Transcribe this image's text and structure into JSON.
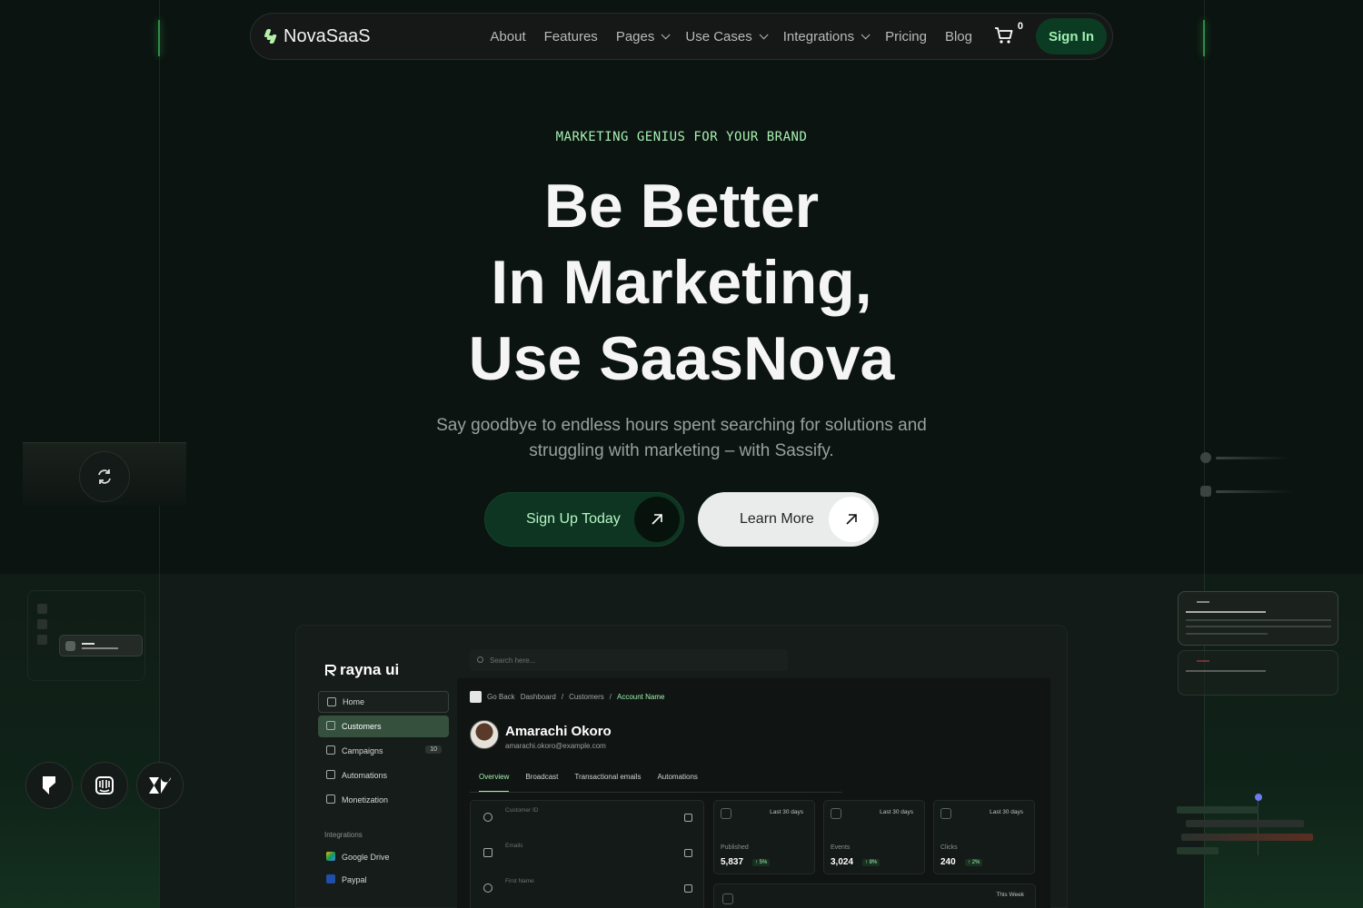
{
  "nav": {
    "brand": "NovaSaaS",
    "links": [
      {
        "label": "About"
      },
      {
        "label": "Features"
      },
      {
        "label": "Pages"
      },
      {
        "label": "Use Cases"
      },
      {
        "label": "Integrations"
      },
      {
        "label": "Pricing"
      },
      {
        "label": "Blog"
      }
    ],
    "cart_count": "0",
    "signin_label": "Sign In"
  },
  "hero": {
    "eyebrow": "MARKETING GENIUS FOR YOUR BRAND",
    "headline_lines": [
      "Be Better",
      "In Marketing,",
      "Use SaasNova"
    ],
    "subtitle": "Say goodbye to endless hours spent searching for solutions and struggling with marketing – with Sassify.",
    "primary_cta": "Sign Up Today",
    "secondary_cta": "Learn More"
  },
  "integration_icons": [
    "framer-icon",
    "intercom-icon",
    "zendesk-icon"
  ],
  "dashboard": {
    "logo": "rayna ui",
    "search_placeholder": "Search here...",
    "sidebar": {
      "items": [
        {
          "label": "Home"
        },
        {
          "label": "Customers"
        },
        {
          "label": "Campaigns",
          "badge": "10"
        },
        {
          "label": "Automations"
        },
        {
          "label": "Monetization"
        }
      ],
      "integrations_heading": "Integrations",
      "integrations": [
        {
          "label": "Google Drive"
        },
        {
          "label": "Paypal"
        }
      ]
    },
    "breadcrumb": {
      "back": "Go Back",
      "items": [
        "Dashboard",
        "Customers"
      ],
      "current": "Account Name"
    },
    "profile": {
      "name": "Amarachi Okoro",
      "email": "amarachi.okoro@example.com"
    },
    "tabs": [
      "Overview",
      "Broadcast",
      "Transactional emails",
      "Automations"
    ],
    "fields": [
      "Customer ID",
      "Emails",
      "First Name"
    ],
    "stats": [
      {
        "range": "Last 30 days",
        "label": "Published",
        "value": "5,837",
        "delta": "5%"
      },
      {
        "range": "Last 30 days",
        "label": "Events",
        "value": "3,024",
        "delta": "8%"
      },
      {
        "range": "Last 30 days",
        "label": "Clicks",
        "value": "240",
        "delta": "2%"
      }
    ],
    "week_range": "This Week"
  },
  "colors": {
    "accent": "#9ff0b0",
    "background": "#0b1410",
    "primary_button": "#0d3522"
  }
}
